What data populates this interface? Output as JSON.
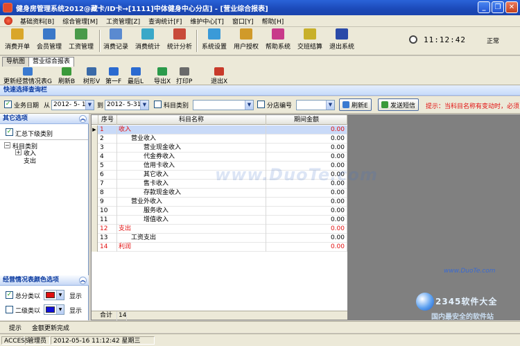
{
  "window": {
    "title": "健身房管理系统2012@藏卡/ID卡→[1111]中体健身中心分店] - [营业综合报表]"
  },
  "window_buttons": {
    "minimize": "_",
    "restore": "❐",
    "close": "✕"
  },
  "menu": [
    "基础资料[B]",
    "综合管理[M]",
    "工资管理[Z]",
    "查询统计[F]",
    "维护中心[T]",
    "窗口[Y]",
    "帮助[H]"
  ],
  "toolbar": [
    {
      "label": "消费开单",
      "icon": "cash-register-icon",
      "color": "#d9a62a"
    },
    {
      "label": "会员管理",
      "icon": "members-icon",
      "color": "#3a78c8"
    },
    {
      "label": "工资管理",
      "icon": "salary-icon",
      "color": "#4a9a4a"
    },
    {
      "label": "消费记录",
      "icon": "records-icon",
      "color": "#5a8ad0"
    },
    {
      "label": "消费统计",
      "icon": "statistics-icon",
      "color": "#3aa8c8"
    },
    {
      "label": "统计分析",
      "icon": "analysis-icon",
      "color": "#c84a3a"
    },
    {
      "label": "系统设置",
      "icon": "settings-icon",
      "color": "#3a9ad8"
    },
    {
      "label": "用户授权",
      "icon": "user-auth-icon",
      "color": "#d09a2a"
    },
    {
      "label": "帮助系统",
      "icon": "help-icon",
      "color": "#c83a8a"
    },
    {
      "label": "交班结算",
      "icon": "shift-settle-icon",
      "color": "#c8b02a"
    },
    {
      "label": "退出系统",
      "icon": "exit-icon",
      "color": "#2a4aa8"
    }
  ],
  "clock": {
    "time": "11:12:42",
    "status": "正常"
  },
  "tabs": [
    "导航图",
    "营业综合报表"
  ],
  "report_toolbar": [
    {
      "label": "更新经营情况表G",
      "icon": "refresh-report-icon",
      "color": "#3a7ad0"
    },
    {
      "label": "刷新B",
      "icon": "refresh-icon",
      "color": "#3a9a3a"
    },
    {
      "label": "树形V",
      "icon": "tree-icon",
      "color": "#3a6aa8"
    },
    {
      "label": "第一F",
      "icon": "first-record-icon",
      "color": "#2a6ad0"
    },
    {
      "label": "最后L",
      "icon": "last-record-icon",
      "color": "#2a6ad0"
    },
    {
      "label": "导出X",
      "icon": "export-icon",
      "color": "#2a9a4a"
    },
    {
      "label": "打印P",
      "icon": "printer-icon",
      "color": "#6a6a6a"
    },
    {
      "label": "退出X",
      "icon": "exit-icon",
      "color": "#c83a2a"
    }
  ],
  "query": {
    "title": "快速选择查询栏",
    "date_label": "业务日期",
    "from_label": "从",
    "to_label": "到",
    "from_date": "2012- 5- 1",
    "to_date": "2012- 5-31",
    "category_label": "科目类别",
    "category_value": "",
    "branch_label": "分店编号",
    "branch_value": "",
    "refresh_label": "刷新E",
    "sms_label": "发送短信",
    "hint": "提示：当科目名称有变动时，必须"
  },
  "left_panel": {
    "other_options_title": "其它选项",
    "summary_label": "汇总下级类别",
    "tree_root": "科目类别",
    "tree_children": [
      "收入",
      "支出"
    ],
    "color_options_title": "经营情况表颜色选项",
    "color_rows": [
      {
        "label": "总分类以",
        "checked": true,
        "color": "#e01010",
        "show": "显示"
      },
      {
        "label": "二级类以",
        "checked": false,
        "color": "#1010d8",
        "show": "显示"
      }
    ]
  },
  "grid": {
    "columns": [
      "序号",
      "科目名称",
      "期间金额"
    ],
    "rows": [
      {
        "no": "1",
        "name": "收入",
        "indent": 0,
        "amount": "0.00",
        "highlight": true
      },
      {
        "no": "2",
        "name": "营业收入",
        "indent": 1,
        "amount": "0.00",
        "highlight": false
      },
      {
        "no": "3",
        "name": "营业现金收入",
        "indent": 2,
        "amount": "0.00",
        "highlight": false
      },
      {
        "no": "4",
        "name": "代金券收入",
        "indent": 2,
        "amount": "0.00",
        "highlight": false
      },
      {
        "no": "5",
        "name": "信用卡收入",
        "indent": 2,
        "amount": "0.00",
        "highlight": false
      },
      {
        "no": "6",
        "name": "其它收入",
        "indent": 2,
        "amount": "0.00",
        "highlight": false
      },
      {
        "no": "7",
        "name": "售卡收入",
        "indent": 2,
        "amount": "0.00",
        "highlight": false
      },
      {
        "no": "8",
        "name": "存款现金收入",
        "indent": 2,
        "amount": "0.00",
        "highlight": false
      },
      {
        "no": "9",
        "name": "营业外收入",
        "indent": 1,
        "amount": "0.00",
        "highlight": false
      },
      {
        "no": "10",
        "name": "服务收入",
        "indent": 2,
        "amount": "0.00",
        "highlight": false
      },
      {
        "no": "11",
        "name": "增值收入",
        "indent": 2,
        "amount": "0.00",
        "highlight": false
      },
      {
        "no": "12",
        "name": "支出",
        "indent": 0,
        "amount": "0.00",
        "highlight": true
      },
      {
        "no": "13",
        "name": "工资支出",
        "indent": 1,
        "amount": "0.00",
        "highlight": false
      },
      {
        "no": "14",
        "name": "利润",
        "indent": 0,
        "amount": "0.00",
        "highlight": true
      }
    ],
    "footer_label": "合计",
    "footer_count": "14"
  },
  "watermark": {
    "main": "www.DuoTe.com",
    "small": "www.DuoTe.com",
    "brand": "2345软件大全",
    "slogan": "国内最安全的软件站"
  },
  "bottom_tabs": [
    "提示",
    "金额更新完成"
  ],
  "status": [
    "ACCESS",
    "管理员",
    "2012-05-16 11:12:42 星期三"
  ],
  "colors": {
    "highlight_text": "#e21010",
    "title_gradient": "#2a63d8",
    "selected_row": "#c9daf8"
  }
}
